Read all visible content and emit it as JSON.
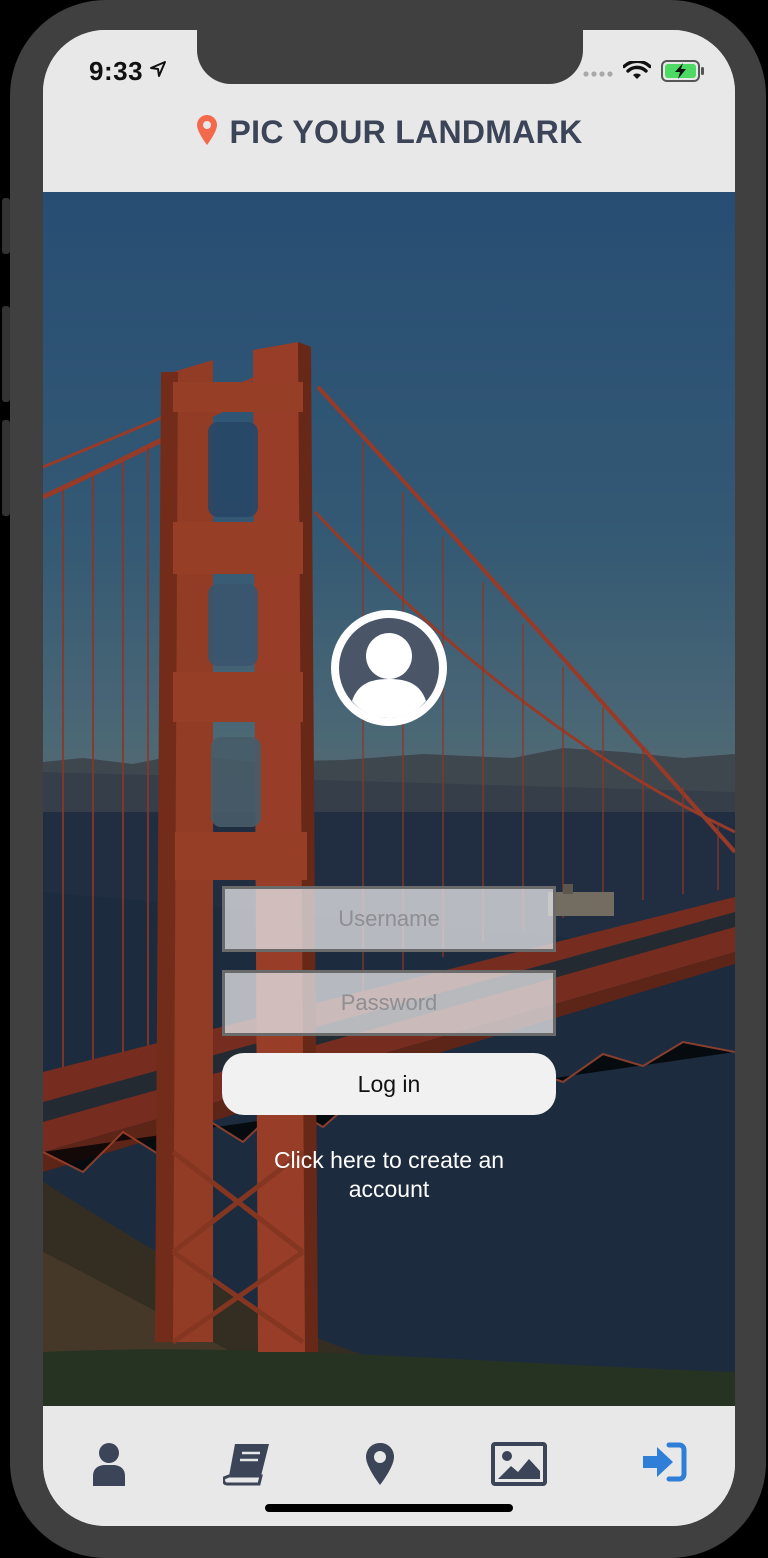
{
  "status_bar": {
    "time": "9:33"
  },
  "header": {
    "title": "PIC YOUR LANDMARK",
    "icon": "map-pin-icon",
    "icon_color": "#f26a4b"
  },
  "login": {
    "avatar_icon": "user-circle-icon",
    "username_placeholder": "Username",
    "username_value": "",
    "password_placeholder": "Password",
    "password_value": "",
    "login_button_label": "Log in",
    "create_account_link": "Click here to create an account"
  },
  "tab_bar": {
    "items": [
      {
        "icon": "user-icon",
        "active": false
      },
      {
        "icon": "book-icon",
        "active": false
      },
      {
        "icon": "map-marker-icon",
        "active": false
      },
      {
        "icon": "image-icon",
        "active": false
      },
      {
        "icon": "sign-in-icon",
        "active": true
      }
    ],
    "inactive_color": "#3b4557",
    "active_color": "#2f7ed8"
  }
}
